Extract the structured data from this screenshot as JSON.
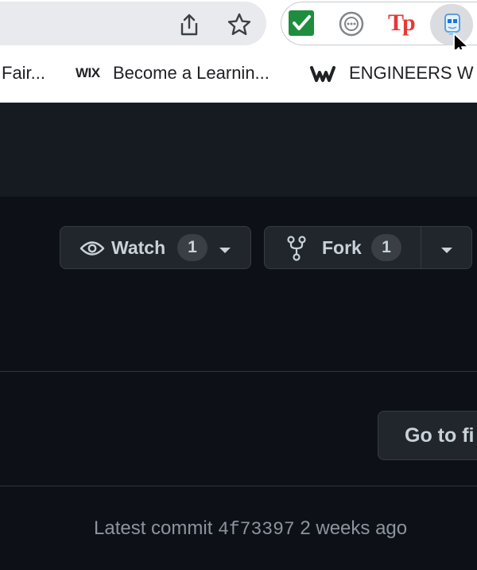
{
  "browser": {
    "bookmarks": [
      {
        "label": "Fair...",
        "icon": "none"
      },
      {
        "label": "Become a Learnin...",
        "icon": "wix-logo",
        "logo_text": "WIX"
      },
      {
        "label": "ENGINEERS W",
        "icon": "weebly-logo"
      }
    ],
    "toolbar_icons": [
      "share-icon",
      "star-icon"
    ],
    "extensions": [
      {
        "name": "checkmark-extension-icon",
        "color": "#1e8e3e"
      },
      {
        "name": "chat-extension-icon",
        "color": "#80868b"
      },
      {
        "name": "tp-extension-icon",
        "text": "Tp",
        "color": "#e53935"
      },
      {
        "name": "mascot-extension-icon",
        "color": "#5f9ede"
      }
    ]
  },
  "repo": {
    "watch": {
      "label": "Watch",
      "count": "1"
    },
    "fork": {
      "label": "Fork",
      "count": "1"
    },
    "go_to_file": "Go to fi",
    "commit": {
      "prefix": "Latest commit",
      "hash": "4f73397",
      "time": "2 weeks ago"
    }
  },
  "colors": {
    "bg": "#0d1117",
    "header": "#161b22",
    "button": "#21262d",
    "text": "#c9d1d9",
    "muted": "#8b949e"
  }
}
